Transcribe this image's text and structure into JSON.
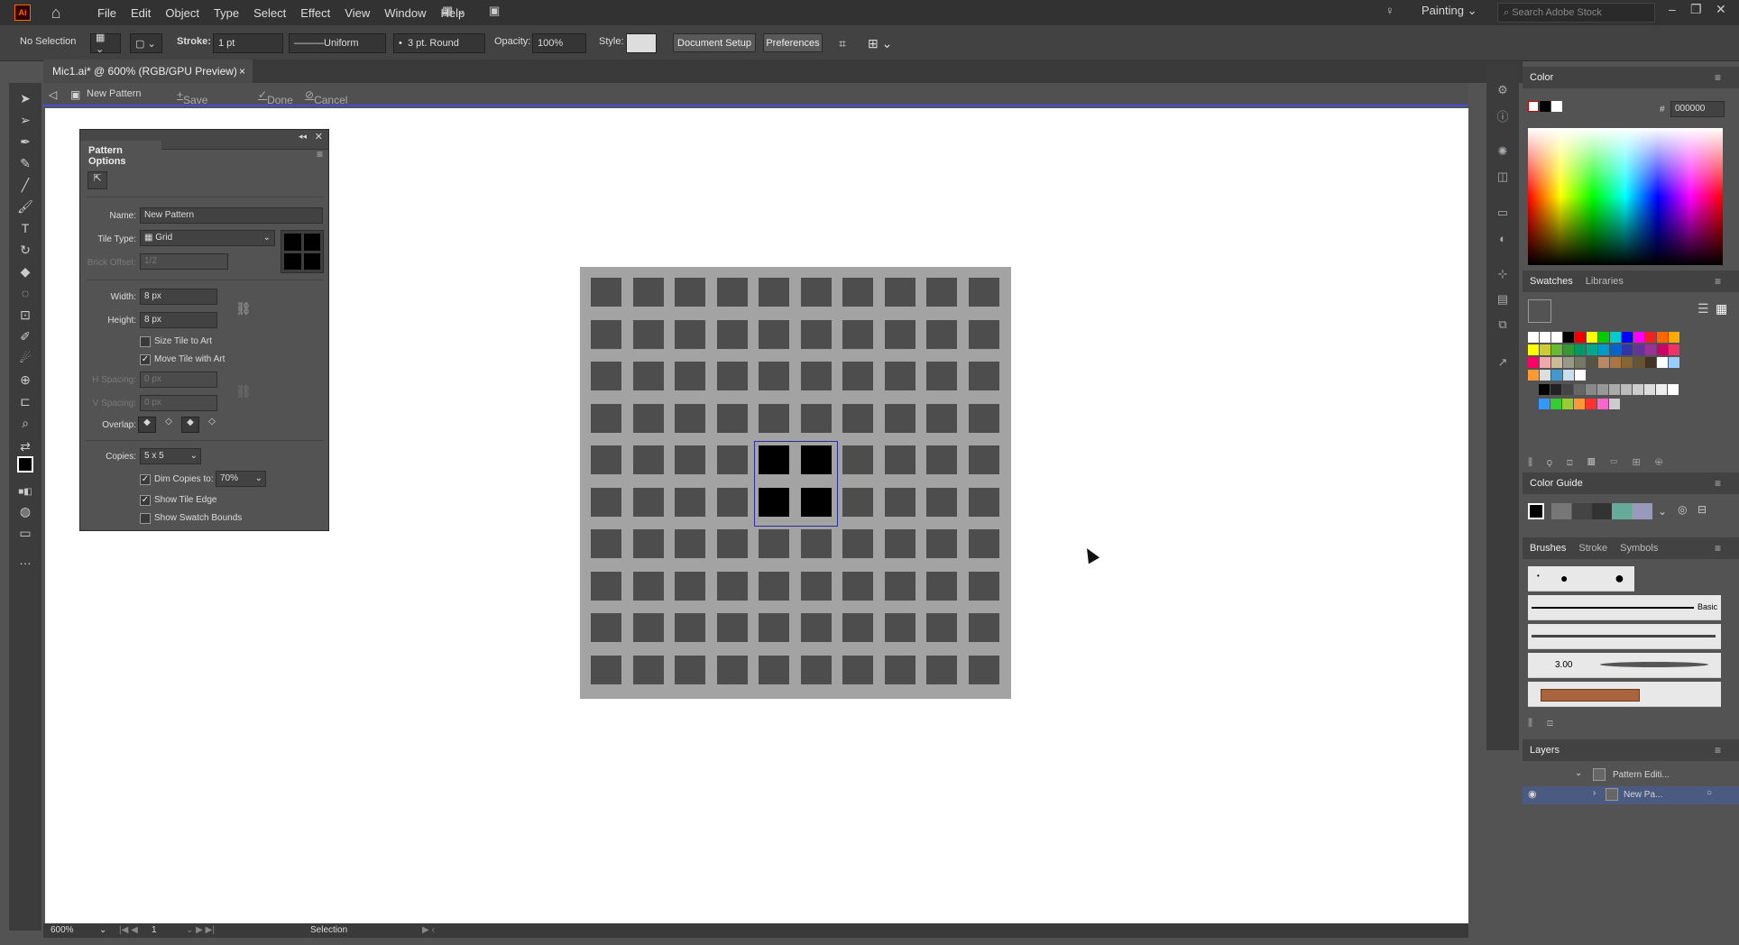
{
  "app": {
    "logo": "Ai",
    "menus": [
      "File",
      "Edit",
      "Object",
      "Type",
      "Select",
      "Effect",
      "View",
      "Window",
      "Help"
    ],
    "workspace": "Painting",
    "search_placeholder": "Search Adobe Stock"
  },
  "control": {
    "selection": "No Selection",
    "stroke_label": "Stroke:",
    "stroke_value": "1 pt",
    "profile": "Uniform",
    "brush": "3 pt. Round",
    "opacity_label": "Opacity:",
    "opacity_value": "100%",
    "style_label": "Style:",
    "doc_setup": "Document Setup",
    "preferences": "Preferences"
  },
  "document": {
    "tab_title": "Mic1.ai* @ 600% (RGB/GPU Preview)",
    "close": "×"
  },
  "isolation": {
    "label": "New Pattern",
    "save_copy": "Save a Copy",
    "done": "Done",
    "cancel": "Cancel"
  },
  "pattern_options": {
    "title": "Pattern Options",
    "name_label": "Name:",
    "name_value": "New Pattern",
    "tile_type_label": "Tile Type:",
    "tile_type_value": "Grid",
    "brick_label": "Brick Offset:",
    "brick_value": "1/2",
    "width_label": "Width:",
    "width_value": "8 px",
    "height_label": "Height:",
    "height_value": "8 px",
    "size_tile": "Size Tile to Art",
    "move_tile": "Move Tile with Art",
    "hspacing_label": "H Spacing:",
    "hspacing_value": "0 px",
    "vspacing_label": "V Spacing:",
    "vspacing_value": "0 px",
    "overlap_label": "Overlap:",
    "copies_label": "Copies:",
    "copies_value": "5 x 5",
    "dim_label": "Dim Copies to:",
    "dim_value": "70%",
    "show_tile_edge": "Show Tile Edge",
    "show_swatch_bounds": "Show Swatch Bounds",
    "size_tile_checked": false,
    "move_tile_checked": true,
    "dim_checked": true,
    "tile_edge_checked": true,
    "swatch_bounds_checked": false
  },
  "color_panel": {
    "title": "Color",
    "hex_label": "#",
    "hex_value": "000000"
  },
  "swatches_panel": {
    "tabs": [
      "Swatches",
      "Libraries"
    ]
  },
  "color_guide": {
    "title": "Color Guide"
  },
  "brushes_panel": {
    "tabs": [
      "Brushes",
      "Stroke",
      "Symbols"
    ],
    "basic_label": "Basic",
    "size_label": "3.00"
  },
  "layers_panel": {
    "title": "Layers",
    "items": [
      "Pattern Editi...",
      "New Pa..."
    ]
  },
  "status": {
    "zoom": "600%",
    "artboard": "1",
    "tool": "Selection"
  },
  "colors": {
    "accent": "#4b4bd9",
    "ui_bg": "#535353",
    "canvas": "#ffffff",
    "pattern_bg": "#a3a3a3",
    "tile": "#4d4d4d"
  }
}
